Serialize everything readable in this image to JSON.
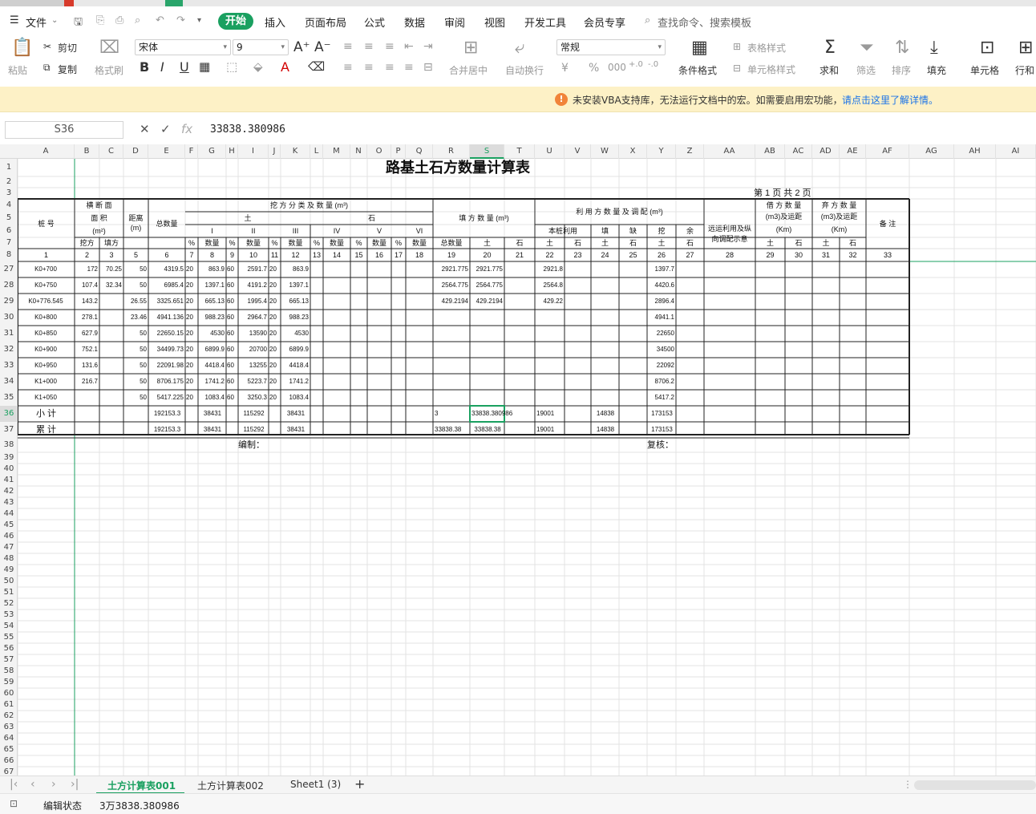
{
  "menu": {
    "file": "文件",
    "start": "开始",
    "insert": "插入",
    "page_layout": "页面布局",
    "formula": "公式",
    "data": "数据",
    "review": "审阅",
    "view": "视图",
    "devtools": "开发工具",
    "member": "会员专享",
    "search_placeholder": "查找命令、搜索模板"
  },
  "ribbon": {
    "cut": "剪切",
    "paste": "粘贴",
    "copy": "复制",
    "format_painter": "格式刷",
    "font": "宋体",
    "size": "9",
    "merge": "合并居中",
    "wrap": "自动换行",
    "numfmt": "常规",
    "cond_fmt": "条件格式",
    "table_style": "表格样式",
    "cell_style": "单元格样式",
    "sum": "求和",
    "filter": "筛选",
    "sort": "排序",
    "fill": "填充",
    "cell": "单元格",
    "row_col": "行和"
  },
  "vba": {
    "message": "未安装VBA支持库，无法运行文档中的宏。如需要启用宏功能，",
    "link": "请点击这里了解详情。"
  },
  "formula_bar": {
    "name_box": "S36",
    "value": "33838.380986"
  },
  "sheet": {
    "title": "路基土石方数量计算表",
    "page_info": "第 1 页   共 2 页",
    "columns": [
      "A",
      "B",
      "C",
      "D",
      "E",
      "F",
      "G",
      "H",
      "I",
      "J",
      "K",
      "L",
      "M",
      "N",
      "O",
      "P",
      "Q",
      "R",
      "S",
      "T",
      "U",
      "V",
      "W",
      "X",
      "Y",
      "Z",
      "AA",
      "AB",
      "AC",
      "AD",
      "AE",
      "AF",
      "AG",
      "AH",
      "AI"
    ],
    "active_col": "S",
    "row_numbers": [
      "1",
      "2",
      "3",
      "4",
      "5",
      "6",
      "7",
      "8",
      "27",
      "28",
      "29",
      "30",
      "31",
      "32",
      "33",
      "34",
      "35",
      "36",
      "37",
      "38",
      "39",
      "40",
      "41",
      "42",
      "43",
      "44",
      "45",
      "46",
      "47",
      "48",
      "49",
      "50",
      "51",
      "52",
      "53",
      "54",
      "55",
      "56",
      "57",
      "58",
      "59",
      "60",
      "61",
      "62",
      "63",
      "64",
      "65",
      "66",
      "67"
    ],
    "active_row": "36",
    "headers": {
      "stake": "桩  号",
      "cross": "横 断 面",
      "area": "面  积",
      "unit_m2": "(m²)",
      "dig": "挖方",
      "fill": "填方",
      "dist": "距离",
      "dist_u": "(m)",
      "excav": "挖 方 分 类 及 数 量 (m³)",
      "earth": "土",
      "rock": "石",
      "total": "总数量",
      "I": "I",
      "II": "II",
      "III": "III",
      "IV": "IV",
      "V": "V",
      "VI": "VI",
      "pct": "%",
      "qty": "数量",
      "fillqty": "填 方 数 量 (m³)",
      "fill_total": "总数量",
      "fill_earth": "土",
      "fill_rock": "石",
      "use": "利 用 方 数 量 及 调 配 (m³)",
      "local": "本桩利用",
      "fill2": "填",
      "left": "缺",
      "dig2": "挖",
      "rem": "余",
      "far": "远运利用及纵",
      "far2": "向调配示意",
      "borrow": "借 方 数 量",
      "borrow2": "(m3)及运距",
      "km": "(Km)",
      "waste": "弃 方 数 量",
      "waste2": "(m3)及运距",
      "note": "备  注",
      "e1": "土",
      "e2": "石"
    },
    "col_index": [
      "1",
      "2",
      "3",
      "5",
      "6",
      "7",
      "8",
      "9",
      "10",
      "11",
      "12",
      "13",
      "14",
      "15",
      "16",
      "17",
      "18",
      "19",
      "20",
      "21",
      "22",
      "23",
      "24",
      "25",
      "26",
      "27",
      "28",
      "29",
      "30",
      "31",
      "32",
      "33"
    ],
    "rows": [
      {
        "a": "K0+700",
        "b": "172",
        "c": "70.25",
        "d": "50",
        "e": "4319.5",
        "f": "20",
        "g": "863.9",
        "h": "60",
        "i": "2591.7",
        "j": "20",
        "k": "863.9",
        "r": "2921.775",
        "s": "2921.775",
        "u": "2921.8",
        "y": "1397.7"
      },
      {
        "a": "K0+750",
        "b": "107.4",
        "c": "32.34",
        "d": "50",
        "e": "6985.4",
        "f": "20",
        "g": "1397.1",
        "h": "60",
        "i": "4191.2",
        "j": "20",
        "k": "1397.1",
        "r": "2564.775",
        "s": "2564.775",
        "u": "2564.8",
        "y": "4420.6"
      },
      {
        "a": "K0+776.545",
        "b": "143.2",
        "c": "",
        "d": "26.55",
        "e": "3325.651",
        "f": "20",
        "g": "665.13",
        "h": "60",
        "i": "1995.4",
        "j": "20",
        "k": "665.13",
        "r": "429.2194",
        "s": "429.2194",
        "u": "429.22",
        "y": "2896.4"
      },
      {
        "a": "K0+800",
        "b": "278.1",
        "c": "",
        "d": "23.46",
        "e": "4941.136",
        "f": "20",
        "g": "988.23",
        "h": "60",
        "i": "2964.7",
        "j": "20",
        "k": "988.23",
        "r": "",
        "s": "",
        "u": "",
        "y": "4941.1"
      },
      {
        "a": "K0+850",
        "b": "627.9",
        "c": "",
        "d": "50",
        "e": "22650.15",
        "f": "20",
        "g": "4530",
        "h": "60",
        "i": "13590",
        "j": "20",
        "k": "4530",
        "r": "",
        "s": "",
        "u": "",
        "y": "22650"
      },
      {
        "a": "K0+900",
        "b": "752.1",
        "c": "",
        "d": "50",
        "e": "34499.73",
        "f": "20",
        "g": "6899.9",
        "h": "60",
        "i": "20700",
        "j": "20",
        "k": "6899.9",
        "r": "",
        "s": "",
        "u": "",
        "y": "34500"
      },
      {
        "a": "K0+950",
        "b": "131.6",
        "c": "",
        "d": "50",
        "e": "22091.98",
        "f": "20",
        "g": "4418.4",
        "h": "60",
        "i": "13255",
        "j": "20",
        "k": "4418.4",
        "r": "",
        "s": "",
        "u": "",
        "y": "22092"
      },
      {
        "a": "K1+000",
        "b": "216.7",
        "c": "",
        "d": "50",
        "e": "8706.175",
        "f": "20",
        "g": "1741.2",
        "h": "60",
        "i": "5223.7",
        "j": "20",
        "k": "1741.2",
        "r": "",
        "s": "",
        "u": "",
        "y": "8706.2"
      },
      {
        "a": "K1+050",
        "b": "",
        "c": "",
        "d": "50",
        "e": "5417.225",
        "f": "20",
        "g": "1083.4",
        "h": "60",
        "i": "3250.3",
        "j": "20",
        "k": "1083.4",
        "r": "",
        "s": "",
        "u": "",
        "y": "5417.2"
      }
    ],
    "subtotal": {
      "label": "小  计",
      "e": "192153.3",
      "g": "38431",
      "i": "115292",
      "k": "38431",
      "r": "3",
      "s": "33838.380986",
      "u": "19001",
      "w": "14838",
      "y": "173153"
    },
    "cumulative": {
      "label": "累  计",
      "e": "192153.3",
      "g": "38431",
      "i": "115292",
      "k": "38431",
      "r": "33838.38",
      "s": "33838.38",
      "u": "19001",
      "w": "14838",
      "y": "173153"
    },
    "compiled": "编制：",
    "reviewed": "复核："
  },
  "tabs": {
    "t1": "土方计算表001",
    "t2": "土方计算表002",
    "t3": "Sheet1 (3)",
    "add": "+"
  },
  "status": {
    "mode": "编辑状态",
    "value": "3万3838.380986"
  },
  "colors": {
    "accent": "#1aa060",
    "warn": "#f1843a",
    "vba_bg": "#fdf1c6"
  }
}
